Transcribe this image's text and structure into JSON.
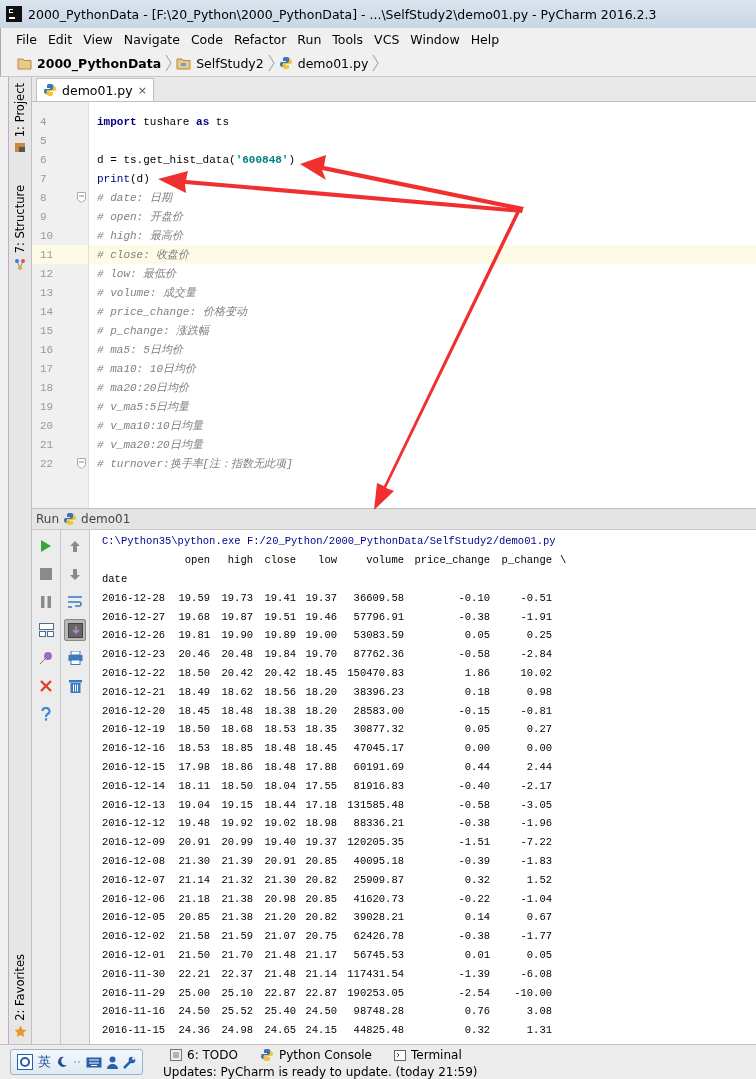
{
  "window": {
    "title": "2000_PythonData - [F:\\20_Python\\2000_PythonData] - ...\\SelfStudy2\\demo01.py - PyCharm 2016.2.3"
  },
  "menu": [
    "File",
    "Edit",
    "View",
    "Navigate",
    "Code",
    "Refactor",
    "Run",
    "Tools",
    "VCS",
    "Window",
    "Help"
  ],
  "breadcrumbs": [
    {
      "kind": "project",
      "label": "2000_PythonData"
    },
    {
      "kind": "folder",
      "label": "SelfStudy2"
    },
    {
      "kind": "file",
      "label": "demo01.py"
    }
  ],
  "side_stripe": {
    "top": [
      {
        "kind": "project",
        "label": "1: Project"
      },
      {
        "kind": "structure",
        "label": "7: Structure"
      }
    ],
    "bottom": [
      {
        "kind": "favorites",
        "label": "2: Favorites"
      }
    ]
  },
  "editor": {
    "tabs": [
      {
        "label": "demo01.py",
        "close": "×",
        "selected": true
      }
    ],
    "lines": [
      {
        "number": "4",
        "current": false,
        "fold": false,
        "segments": [
          {
            "kind": "keyword",
            "text": "import"
          },
          {
            "kind": "plain",
            "text": " tushare "
          },
          {
            "kind": "keyword",
            "text": "as"
          },
          {
            "kind": "plain",
            "text": " ts"
          }
        ]
      },
      {
        "number": "5",
        "current": false,
        "fold": false
      },
      {
        "number": "6",
        "current": false,
        "fold": false,
        "segments": [
          {
            "kind": "plain",
            "text": "d = ts.get_hist_data("
          },
          {
            "kind": "string",
            "text": "'600848'"
          },
          {
            "kind": "plain",
            "text": ")"
          }
        ]
      },
      {
        "number": "7",
        "current": false,
        "fold": false,
        "segments": [
          {
            "kind": "builtin",
            "text": "print"
          },
          {
            "kind": "plain",
            "text": "(d)"
          }
        ]
      },
      {
        "number": "8",
        "current": false,
        "fold": true,
        "segments": [
          {
            "kind": "comment",
            "text": "# date: 日期"
          }
        ]
      },
      {
        "number": "9",
        "current": false,
        "fold": false,
        "segments": [
          {
            "kind": "comment",
            "text": "# open: 开盘价"
          }
        ]
      },
      {
        "number": "10",
        "current": false,
        "fold": false,
        "segments": [
          {
            "kind": "comment",
            "text": "# high: 最高价"
          }
        ]
      },
      {
        "number": "11",
        "current": true,
        "fold": false,
        "segments": [
          {
            "kind": "comment",
            "text": "# close: 收盘价"
          }
        ]
      },
      {
        "number": "12",
        "current": false,
        "fold": false,
        "segments": [
          {
            "kind": "comment",
            "text": "# low: 最低价"
          }
        ]
      },
      {
        "number": "13",
        "current": false,
        "fold": false,
        "segments": [
          {
            "kind": "comment",
            "text": "# volume: 成交量"
          }
        ]
      },
      {
        "number": "14",
        "current": false,
        "fold": false,
        "segments": [
          {
            "kind": "comment",
            "text": "# price_change: 价格变动"
          }
        ]
      },
      {
        "number": "15",
        "current": false,
        "fold": false,
        "segments": [
          {
            "kind": "comment",
            "text": "# p_change: 涨跌幅"
          }
        ]
      },
      {
        "number": "16",
        "current": false,
        "fold": false,
        "segments": [
          {
            "kind": "comment",
            "text": "# ma5: 5日均价"
          }
        ]
      },
      {
        "number": "17",
        "current": false,
        "fold": false,
        "segments": [
          {
            "kind": "comment",
            "text": "# ma10: 10日均价"
          }
        ]
      },
      {
        "number": "18",
        "current": false,
        "fold": false,
        "segments": [
          {
            "kind": "comment",
            "text": "# ma20:20日均价"
          }
        ]
      },
      {
        "number": "19",
        "current": false,
        "fold": false,
        "segments": [
          {
            "kind": "comment",
            "text": "# v_ma5:5日均量"
          }
        ]
      },
      {
        "number": "20",
        "current": false,
        "fold": false,
        "segments": [
          {
            "kind": "comment",
            "text": "# v_ma10:10日均量"
          }
        ]
      },
      {
        "number": "21",
        "current": false,
        "fold": false,
        "segments": [
          {
            "kind": "comment",
            "text": "# v_ma20:20日均量"
          }
        ]
      },
      {
        "number": "22",
        "current": false,
        "fold": true,
        "segments": [
          {
            "kind": "comment",
            "text": "# turnover:换手率[注：指数无此项]"
          }
        ]
      }
    ]
  },
  "run": {
    "label": "Run",
    "config": "demo01",
    "left_tools": [
      {
        "kind": "run",
        "disabled": false
      },
      {
        "kind": "stop",
        "disabled": true
      },
      {
        "kind": "pause",
        "disabled": true
      },
      {
        "kind": "layout",
        "disabled": false
      },
      {
        "kind": "pin",
        "disabled": false
      },
      {
        "kind": "close",
        "disabled": false
      },
      {
        "kind": "help",
        "disabled": false
      }
    ],
    "right_tools": [
      {
        "kind": "up",
        "on": false
      },
      {
        "kind": "down",
        "on": false
      },
      {
        "kind": "wrap",
        "on": false
      },
      {
        "kind": "scroll",
        "on": true
      },
      {
        "kind": "print",
        "on": false
      },
      {
        "kind": "trash",
        "on": false
      }
    ],
    "command": "C:\\Python35\\python.exe F:/20_Python/2000_PythonData/SelfStudy2/demo01.py",
    "columns": [
      "",
      "open",
      "high",
      "close",
      "low",
      "volume",
      "price_change",
      "p_change",
      "\\"
    ],
    "index_name": "date",
    "rows": [
      [
        "2016-12-28",
        "19.59",
        "19.73",
        "19.41",
        "19.37",
        "36609.58",
        "-0.10",
        "-0.51"
      ],
      [
        "2016-12-27",
        "19.68",
        "19.87",
        "19.51",
        "19.46",
        "57796.91",
        "-0.38",
        "-1.91"
      ],
      [
        "2016-12-26",
        "19.81",
        "19.90",
        "19.89",
        "19.00",
        "53083.59",
        "0.05",
        "0.25"
      ],
      [
        "2016-12-23",
        "20.46",
        "20.48",
        "19.84",
        "19.70",
        "87762.36",
        "-0.58",
        "-2.84"
      ],
      [
        "2016-12-22",
        "18.50",
        "20.42",
        "20.42",
        "18.45",
        "150470.83",
        "1.86",
        "10.02"
      ],
      [
        "2016-12-21",
        "18.49",
        "18.62",
        "18.56",
        "18.20",
        "38396.23",
        "0.18",
        "0.98"
      ],
      [
        "2016-12-20",
        "18.45",
        "18.48",
        "18.38",
        "18.20",
        "28583.00",
        "-0.15",
        "-0.81"
      ],
      [
        "2016-12-19",
        "18.50",
        "18.68",
        "18.53",
        "18.35",
        "30877.32",
        "0.05",
        "0.27"
      ],
      [
        "2016-12-16",
        "18.53",
        "18.85",
        "18.48",
        "18.45",
        "47045.17",
        "0.00",
        "0.00"
      ],
      [
        "2016-12-15",
        "17.98",
        "18.86",
        "18.48",
        "17.88",
        "60191.69",
        "0.44",
        "2.44"
      ],
      [
        "2016-12-14",
        "18.11",
        "18.50",
        "18.04",
        "17.55",
        "81916.83",
        "-0.40",
        "-2.17"
      ],
      [
        "2016-12-13",
        "19.04",
        "19.15",
        "18.44",
        "17.18",
        "131585.48",
        "-0.58",
        "-3.05"
      ],
      [
        "2016-12-12",
        "19.48",
        "19.92",
        "19.02",
        "18.98",
        "88336.21",
        "-0.38",
        "-1.96"
      ],
      [
        "2016-12-09",
        "20.91",
        "20.99",
        "19.40",
        "19.37",
        "120205.35",
        "-1.51",
        "-7.22"
      ],
      [
        "2016-12-08",
        "21.30",
        "21.39",
        "20.91",
        "20.85",
        "40095.18",
        "-0.39",
        "-1.83"
      ],
      [
        "2016-12-07",
        "21.14",
        "21.32",
        "21.30",
        "20.82",
        "25909.87",
        "0.32",
        "1.52"
      ],
      [
        "2016-12-06",
        "21.18",
        "21.38",
        "20.98",
        "20.85",
        "41620.73",
        "-0.22",
        "-1.04"
      ],
      [
        "2016-12-05",
        "20.85",
        "21.38",
        "21.20",
        "20.82",
        "39028.21",
        "0.14",
        "0.67"
      ],
      [
        "2016-12-02",
        "21.58",
        "21.59",
        "21.07",
        "20.75",
        "62426.78",
        "-0.38",
        "-1.77"
      ],
      [
        "2016-12-01",
        "21.50",
        "21.70",
        "21.48",
        "21.17",
        "56745.53",
        "0.01",
        "0.05"
      ],
      [
        "2016-11-30",
        "22.21",
        "22.37",
        "21.48",
        "21.14",
        "117431.54",
        "-1.39",
        "-6.08"
      ],
      [
        "2016-11-29",
        "25.00",
        "25.10",
        "22.87",
        "22.87",
        "190253.05",
        "-2.54",
        "-10.00"
      ],
      [
        "2016-11-16",
        "24.50",
        "25.52",
        "25.40",
        "24.50",
        "98748.28",
        "0.76",
        "3.08"
      ],
      [
        "2016-11-15",
        "24.36",
        "24.98",
        "24.65",
        "24.15",
        "44825.48",
        "0.32",
        "1.31"
      ]
    ]
  },
  "bottom_tabs": [
    {
      "kind": "todo",
      "label": "6: TODO"
    },
    {
      "kind": "console",
      "label": "Python Console"
    },
    {
      "kind": "terminal",
      "label": "Terminal"
    }
  ],
  "ime": {
    "mode": "英"
  },
  "status_bar": "Updates: PyCharm is ready to update. (today 21:59)"
}
